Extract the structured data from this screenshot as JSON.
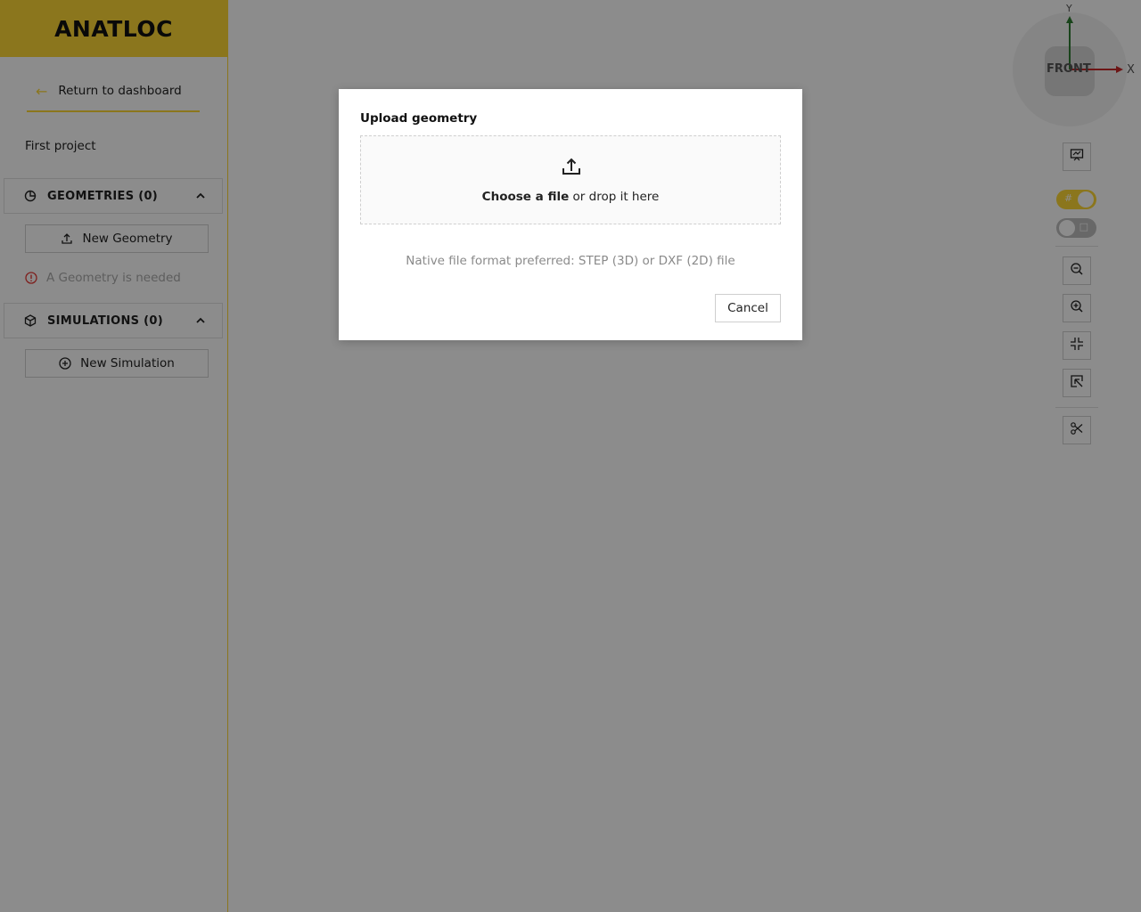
{
  "app": {
    "logo": "ANATLOC",
    "brand_color": "#fdd835"
  },
  "sidebar": {
    "back_label": "Return to dashboard",
    "project_name": "First project",
    "geometries": {
      "title": "GEOMETRIES (0)",
      "new_button": "New Geometry",
      "warning": "A Geometry is needed"
    },
    "simulations": {
      "title": "SIMULATIONS (0)",
      "new_button": "New Simulation"
    }
  },
  "viewer": {
    "cube": {
      "face": "FRONT",
      "axis_y": "Y",
      "axis_x": "X"
    },
    "toggle_grid": {
      "glyph": "#",
      "on": true
    },
    "toggle_box": {
      "glyph": "□",
      "on": false
    },
    "tools": [
      "present-icon",
      "zoom-out-icon",
      "zoom-in-icon",
      "fit-view-icon",
      "select-region-icon",
      "cut-icon"
    ]
  },
  "modal": {
    "title": "Upload geometry",
    "dropzone_strong": "Choose a file",
    "dropzone_rest": " or drop it here",
    "hint": "Native file format preferred: STEP (3D) or DXF (2D) file",
    "cancel": "Cancel"
  }
}
